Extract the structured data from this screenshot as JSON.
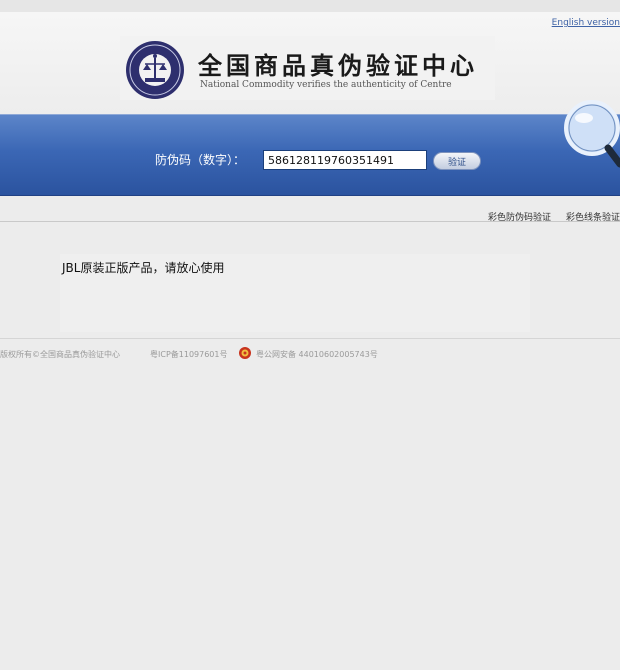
{
  "header": {
    "english_link": "English version",
    "title_cn": "全国商品真伪验证中心",
    "title_en": "National Commodity verifies the authenticity of Centre"
  },
  "search": {
    "label": "防伪码（数字）：",
    "code_value": "586128119760351491",
    "button_label": "验证"
  },
  "subnav": {
    "items": [
      "彩色防伪码验证",
      "彩色线条验证"
    ]
  },
  "result": {
    "message": "JBL原装正版产品，请放心使用"
  },
  "footer": {
    "copyright": "版权所有©全国商品真伪验证中心",
    "icp": "粤ICP备11097601号",
    "police": "粤公网安备 44010602005743号"
  },
  "colors": {
    "band_blue": "#3b67b5",
    "link_blue": "#3f63a6",
    "seal_navy": "#2e2f6e"
  },
  "icons": {
    "seal": "emblem-seal-icon",
    "magnifier": "magnifier-icon",
    "police": "police-badge-icon"
  }
}
